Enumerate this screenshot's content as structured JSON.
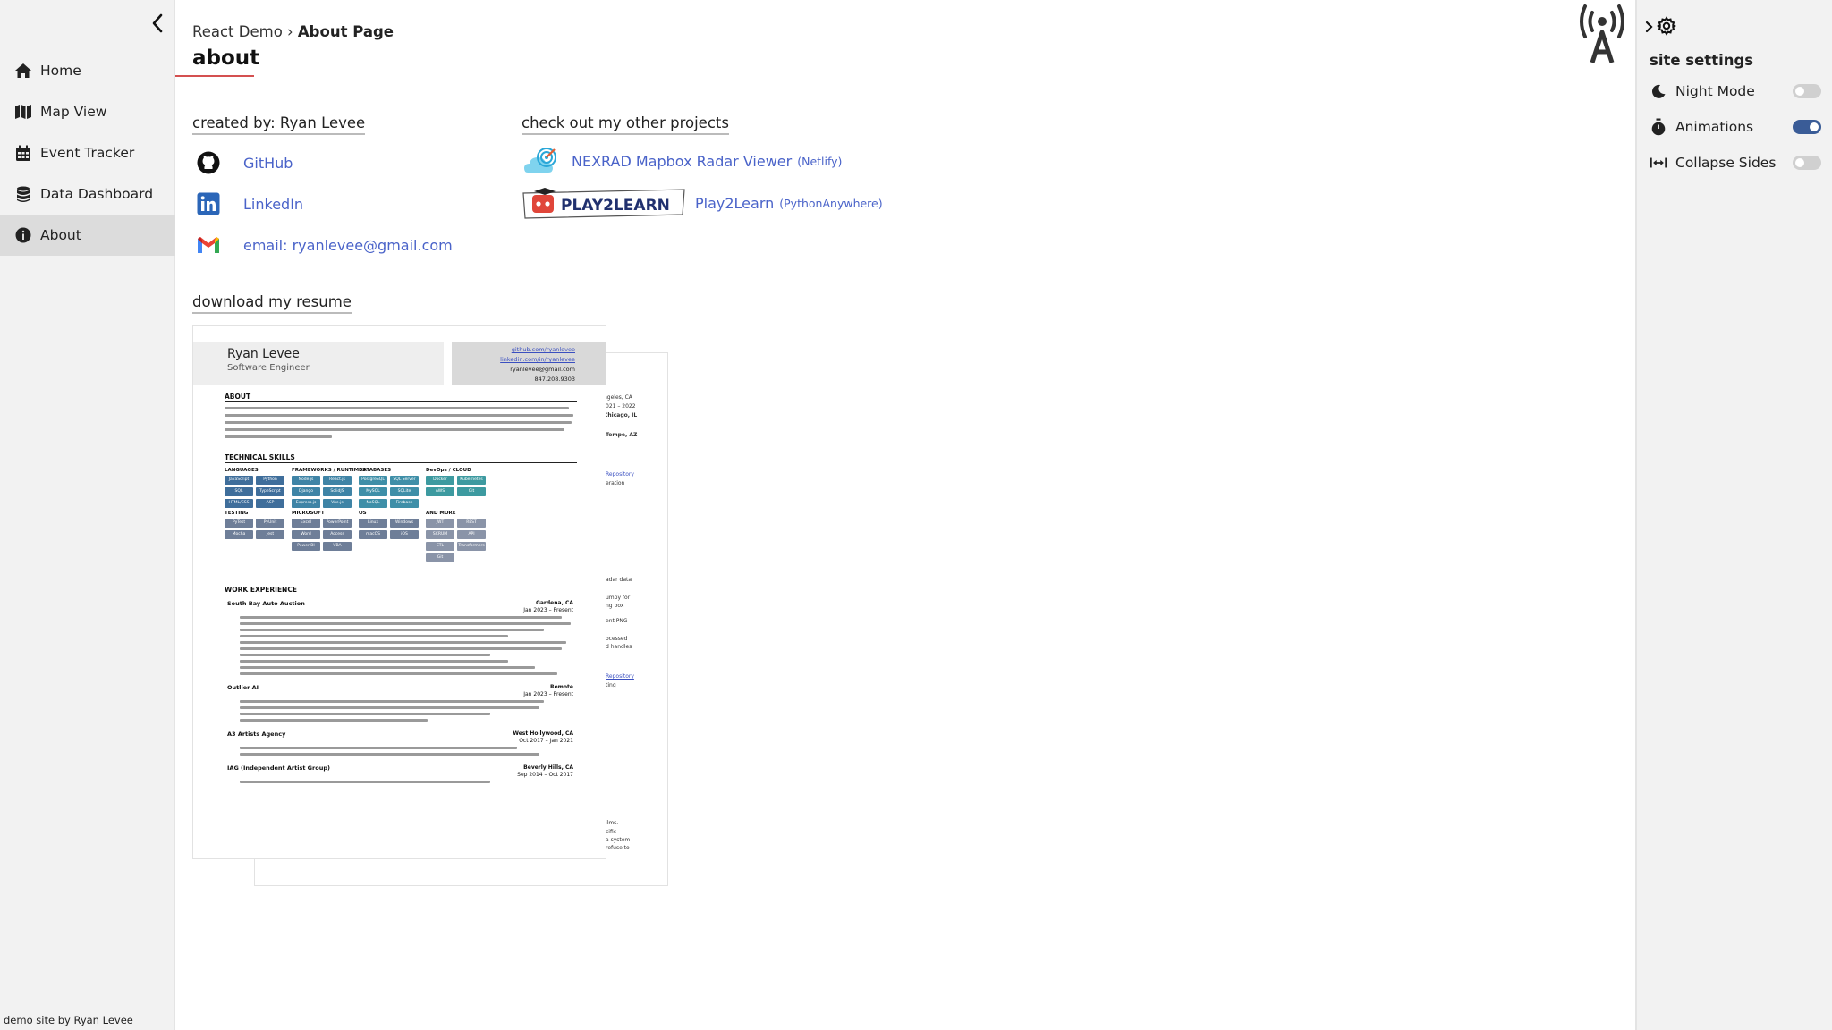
{
  "sidebar": {
    "items": [
      {
        "label": "Home",
        "icon": "home-icon"
      },
      {
        "label": "Map View",
        "icon": "map-icon"
      },
      {
        "label": "Event Tracker",
        "icon": "calendar-icon"
      },
      {
        "label": "Data Dashboard",
        "icon": "database-icon"
      },
      {
        "label": "About",
        "icon": "info-icon",
        "active": true
      }
    ],
    "footer": "demo site by Ryan Levee"
  },
  "breadcrumb": {
    "root": "React Demo",
    "separator": "›",
    "current": "About Page"
  },
  "page_title": "about",
  "created_by": {
    "heading": "created by: Ryan Levee",
    "links": [
      {
        "label": "GitHub",
        "icon": "github-icon"
      },
      {
        "label": "LinkedIn",
        "icon": "linkedin-icon"
      },
      {
        "label": "email: ryanlevee@gmail.com",
        "icon": "gmail-icon"
      }
    ]
  },
  "projects": {
    "heading": "check out my other projects",
    "items": [
      {
        "label": "NEXRAD Mapbox Radar Viewer",
        "host": "(Netlify)",
        "icon": "radar-logo-icon"
      },
      {
        "label": "Play2Learn",
        "host": "(PythonAnywhere)",
        "icon": "play2learn-logo-icon",
        "logo_text": "PLAY2LEARN"
      }
    ]
  },
  "resume": {
    "heading": "download my resume",
    "name": "Ryan Levee",
    "role": "Software Engineer",
    "contacts": [
      "github.com/ryanlevee",
      "linkedin.com/in/ryanlevee",
      "ryanlevee@gmail.com",
      "847.208.9303"
    ],
    "sections": {
      "about": "ABOUT",
      "skills": "TECHNICAL SKILLS",
      "experience": "WORK EXPERIENCE"
    },
    "skill_groups": [
      {
        "title": "LANGUAGES",
        "color": "#3f6e9b",
        "tags": [
          "JavaScript",
          "Python",
          "SQL",
          "TypeScript",
          "HTML/CSS",
          "ASP"
        ]
      },
      {
        "title": "FRAMEWORKS / RUNTIMES",
        "color": "#3f84a6",
        "tags": [
          "Node.js",
          "React.js",
          "Django",
          "SolidJS",
          "Express.js",
          "Vue.js"
        ]
      },
      {
        "title": "DATABASES",
        "color": "#3f8fa8",
        "tags": [
          "PostgreSQL",
          "SQL Server",
          "MySQL",
          "SQLite",
          "NoSQL",
          "Firebase"
        ]
      },
      {
        "title": "DevOps / CLOUD",
        "color": "#3d9aa0",
        "tags": [
          "Docker",
          "Kubernetes",
          "AWS",
          "Git"
        ]
      },
      {
        "title": "TESTING",
        "color": "#6e7e98",
        "tags": [
          "PyTest",
          "PyUnit",
          "Mocha",
          "Jest"
        ]
      },
      {
        "title": "MICROSOFT",
        "color": "#6e7e98",
        "tags": [
          "Excel",
          "PowerPoint",
          "Word",
          "Access",
          "Power BI",
          "VBA"
        ]
      },
      {
        "title": "OS",
        "color": "#6e7e98",
        "tags": [
          "Linux",
          "Windows",
          "macOS",
          "iOS"
        ]
      },
      {
        "title": "AND MORE",
        "color": "#8a94a8",
        "tags": [
          "JWT",
          "REST",
          "SCRUM",
          "API",
          "ETL",
          "Transformers",
          "Git"
        ]
      }
    ],
    "jobs": [
      {
        "company": "South Bay Auto Auction",
        "location": "Gardena, CA",
        "dates": "Jan 2023 – Present"
      },
      {
        "company": "Outlier AI",
        "location": "Remote",
        "dates": "Jan 2023 – Present"
      },
      {
        "company": "A3 Artists Agency",
        "location": "West Hollywood, CA",
        "dates": "Oct 2017 – Jan 2021"
      },
      {
        "company": "IAG (Independent Artist Group)",
        "location": "Beverly Hills, CA",
        "dates": "Sep 2014 – Oct 2017"
      }
    ],
    "back_page_fragments": [
      "ngeles, CA",
      "021 – 2022",
      "Chicago, IL",
      "Tempe, AZ",
      "Repository",
      "eration",
      "adar data",
      "umpy for",
      "ng box",
      "ent PNG",
      "ocessed",
      "d handles",
      "Repository",
      "ting",
      "ilms.",
      "cific",
      "a system",
      "refuse to"
    ]
  },
  "settings": {
    "title": "site settings",
    "items": [
      {
        "label": "Night Mode",
        "icon": "moon-icon",
        "on": false
      },
      {
        "label": "Animations",
        "icon": "stopwatch-icon",
        "on": true
      },
      {
        "label": "Collapse Sides",
        "icon": "collapse-sides-icon",
        "on": false
      }
    ]
  },
  "colors": {
    "link": "#4a63c9",
    "toggle_on": "#3a5c97",
    "title_underline": "#d45050",
    "sidebar_bg": "#f2f2f2"
  }
}
